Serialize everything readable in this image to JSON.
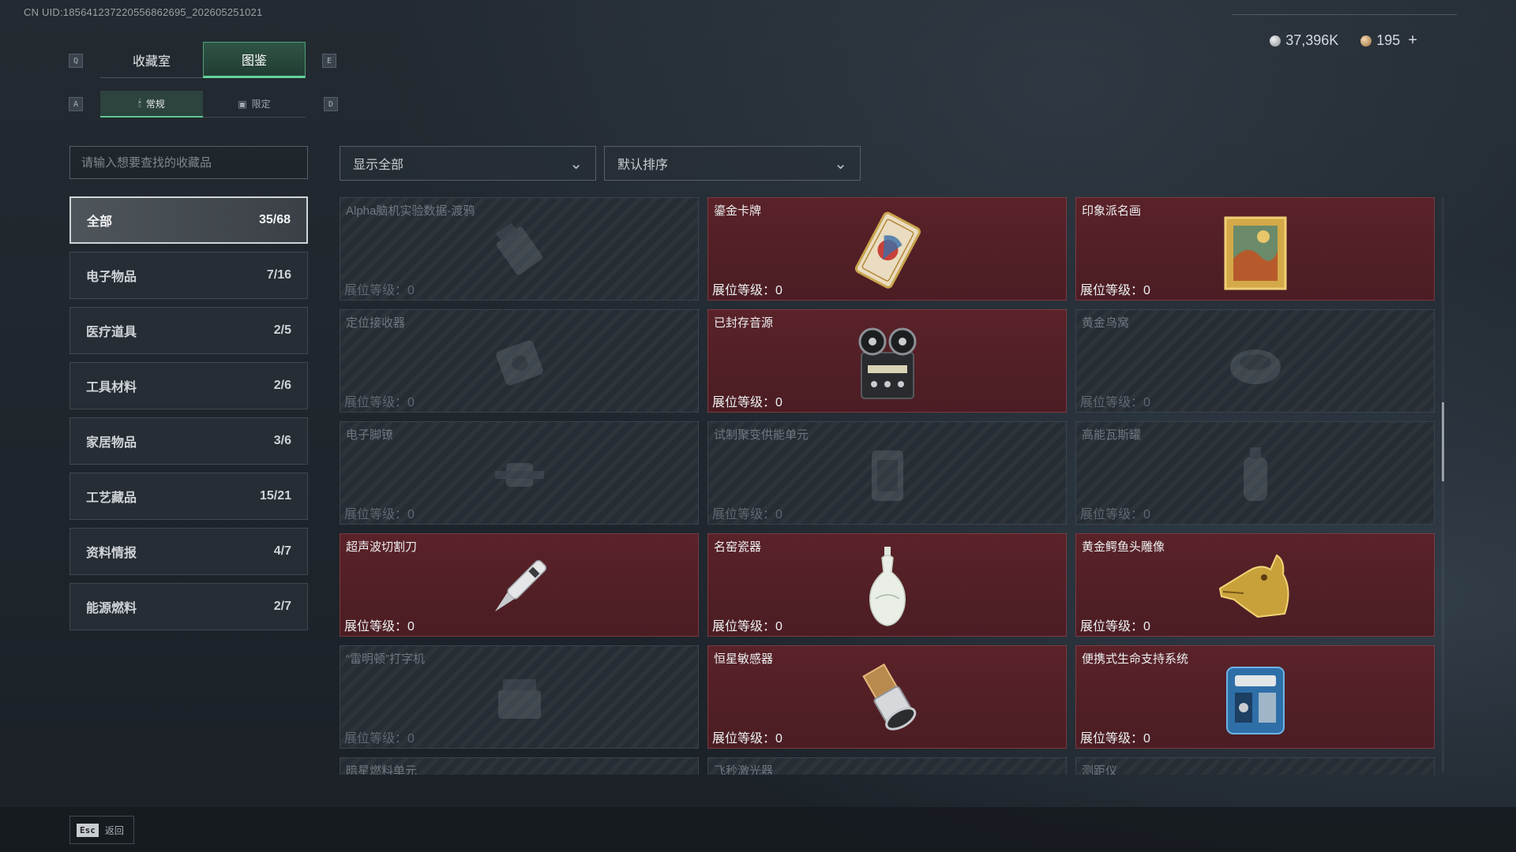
{
  "uid_text": "CN UID:185641237220556862695_202605251021",
  "nav": {
    "key_left": "Q",
    "key_right": "E",
    "tabs": [
      {
        "label": "收藏室"
      },
      {
        "label": "图鉴"
      }
    ],
    "sub_key_left": "A",
    "sub_key_right": "D",
    "subtabs": [
      {
        "label": "常规"
      },
      {
        "label": "限定"
      }
    ]
  },
  "currency": {
    "silver": "37,396K",
    "bronze": "195",
    "plus": "+"
  },
  "search": {
    "placeholder": "请输入想要查找的收藏品"
  },
  "filters": {
    "show": "显示全部",
    "sort": "默认排序"
  },
  "categories": [
    {
      "label": "全部",
      "count": "35/68"
    },
    {
      "label": "电子物品",
      "count": "7/16"
    },
    {
      "label": "医疗道具",
      "count": "2/5"
    },
    {
      "label": "工具材料",
      "count": "2/6"
    },
    {
      "label": "家居物品",
      "count": "3/6"
    },
    {
      "label": "工艺藏品",
      "count": "15/21"
    },
    {
      "label": "资料情报",
      "count": "4/7"
    },
    {
      "label": "能源燃料",
      "count": "2/7"
    }
  ],
  "items": [
    {
      "name": "Alpha脑机实验数据-渡鸦",
      "level": "展位等级：0"
    },
    {
      "name": "鎏金卡牌",
      "level": "展位等级：0"
    },
    {
      "name": "印象派名画",
      "level": "展位等级：0"
    },
    {
      "name": "定位接收器",
      "level": "展位等级：0"
    },
    {
      "name": "已封存音源",
      "level": "展位等级：0"
    },
    {
      "name": "黄金鸟窝",
      "level": "展位等级：0"
    },
    {
      "name": "电子脚镣",
      "level": "展位等级：0"
    },
    {
      "name": "试制聚变供能单元",
      "level": "展位等级：0"
    },
    {
      "name": "高能瓦斯罐",
      "level": "展位等级：0"
    },
    {
      "name": "超声波切割刀",
      "level": "展位等级：0"
    },
    {
      "name": "名窑瓷器",
      "level": "展位等级：0"
    },
    {
      "name": "黄金鳄鱼头雕像",
      "level": "展位等级：0"
    },
    {
      "name": "“雷明顿”打字机",
      "level": "展位等级：0"
    },
    {
      "name": "恒星敏感器",
      "level": "展位等级：0"
    },
    {
      "name": "便携式生命支持系统",
      "level": "展位等级：0"
    },
    {
      "name": "暗星燃料单元",
      "level": ""
    },
    {
      "name": "飞秒激光器",
      "level": ""
    },
    {
      "name": "测距仪",
      "level": ""
    }
  ],
  "footer": {
    "esc": "Esc",
    "back": "返回"
  }
}
